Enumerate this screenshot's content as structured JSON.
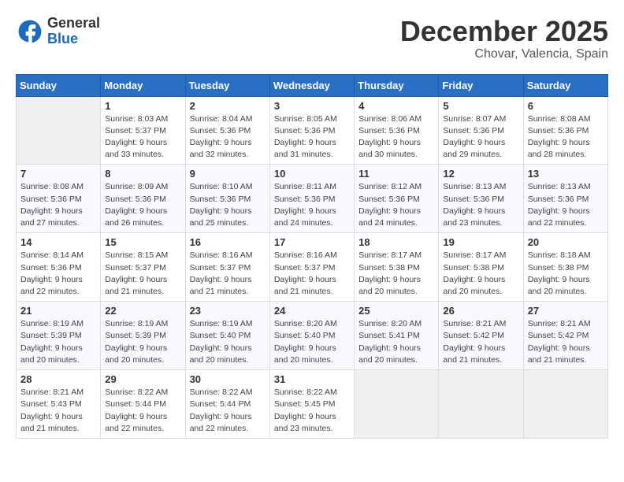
{
  "header": {
    "logo": {
      "general": "General",
      "blue": "Blue"
    },
    "month": "December 2025",
    "location": "Chovar, Valencia, Spain"
  },
  "weekdays": [
    "Sunday",
    "Monday",
    "Tuesday",
    "Wednesday",
    "Thursday",
    "Friday",
    "Saturday"
  ],
  "weeks": [
    [
      {
        "day": "",
        "info": ""
      },
      {
        "day": "1",
        "info": "Sunrise: 8:03 AM\nSunset: 5:37 PM\nDaylight: 9 hours\nand 33 minutes."
      },
      {
        "day": "2",
        "info": "Sunrise: 8:04 AM\nSunset: 5:36 PM\nDaylight: 9 hours\nand 32 minutes."
      },
      {
        "day": "3",
        "info": "Sunrise: 8:05 AM\nSunset: 5:36 PM\nDaylight: 9 hours\nand 31 minutes."
      },
      {
        "day": "4",
        "info": "Sunrise: 8:06 AM\nSunset: 5:36 PM\nDaylight: 9 hours\nand 30 minutes."
      },
      {
        "day": "5",
        "info": "Sunrise: 8:07 AM\nSunset: 5:36 PM\nDaylight: 9 hours\nand 29 minutes."
      },
      {
        "day": "6",
        "info": "Sunrise: 8:08 AM\nSunset: 5:36 PM\nDaylight: 9 hours\nand 28 minutes."
      }
    ],
    [
      {
        "day": "7",
        "info": "Sunrise: 8:08 AM\nSunset: 5:36 PM\nDaylight: 9 hours\nand 27 minutes."
      },
      {
        "day": "8",
        "info": "Sunrise: 8:09 AM\nSunset: 5:36 PM\nDaylight: 9 hours\nand 26 minutes."
      },
      {
        "day": "9",
        "info": "Sunrise: 8:10 AM\nSunset: 5:36 PM\nDaylight: 9 hours\nand 25 minutes."
      },
      {
        "day": "10",
        "info": "Sunrise: 8:11 AM\nSunset: 5:36 PM\nDaylight: 9 hours\nand 24 minutes."
      },
      {
        "day": "11",
        "info": "Sunrise: 8:12 AM\nSunset: 5:36 PM\nDaylight: 9 hours\nand 24 minutes."
      },
      {
        "day": "12",
        "info": "Sunrise: 8:13 AM\nSunset: 5:36 PM\nDaylight: 9 hours\nand 23 minutes."
      },
      {
        "day": "13",
        "info": "Sunrise: 8:13 AM\nSunset: 5:36 PM\nDaylight: 9 hours\nand 22 minutes."
      }
    ],
    [
      {
        "day": "14",
        "info": "Sunrise: 8:14 AM\nSunset: 5:36 PM\nDaylight: 9 hours\nand 22 minutes."
      },
      {
        "day": "15",
        "info": "Sunrise: 8:15 AM\nSunset: 5:37 PM\nDaylight: 9 hours\nand 21 minutes."
      },
      {
        "day": "16",
        "info": "Sunrise: 8:16 AM\nSunset: 5:37 PM\nDaylight: 9 hours\nand 21 minutes."
      },
      {
        "day": "17",
        "info": "Sunrise: 8:16 AM\nSunset: 5:37 PM\nDaylight: 9 hours\nand 21 minutes."
      },
      {
        "day": "18",
        "info": "Sunrise: 8:17 AM\nSunset: 5:38 PM\nDaylight: 9 hours\nand 20 minutes."
      },
      {
        "day": "19",
        "info": "Sunrise: 8:17 AM\nSunset: 5:38 PM\nDaylight: 9 hours\nand 20 minutes."
      },
      {
        "day": "20",
        "info": "Sunrise: 8:18 AM\nSunset: 5:38 PM\nDaylight: 9 hours\nand 20 minutes."
      }
    ],
    [
      {
        "day": "21",
        "info": "Sunrise: 8:19 AM\nSunset: 5:39 PM\nDaylight: 9 hours\nand 20 minutes."
      },
      {
        "day": "22",
        "info": "Sunrise: 8:19 AM\nSunset: 5:39 PM\nDaylight: 9 hours\nand 20 minutes."
      },
      {
        "day": "23",
        "info": "Sunrise: 8:19 AM\nSunset: 5:40 PM\nDaylight: 9 hours\nand 20 minutes."
      },
      {
        "day": "24",
        "info": "Sunrise: 8:20 AM\nSunset: 5:40 PM\nDaylight: 9 hours\nand 20 minutes."
      },
      {
        "day": "25",
        "info": "Sunrise: 8:20 AM\nSunset: 5:41 PM\nDaylight: 9 hours\nand 20 minutes."
      },
      {
        "day": "26",
        "info": "Sunrise: 8:21 AM\nSunset: 5:42 PM\nDaylight: 9 hours\nand 21 minutes."
      },
      {
        "day": "27",
        "info": "Sunrise: 8:21 AM\nSunset: 5:42 PM\nDaylight: 9 hours\nand 21 minutes."
      }
    ],
    [
      {
        "day": "28",
        "info": "Sunrise: 8:21 AM\nSunset: 5:43 PM\nDaylight: 9 hours\nand 21 minutes."
      },
      {
        "day": "29",
        "info": "Sunrise: 8:22 AM\nSunset: 5:44 PM\nDaylight: 9 hours\nand 22 minutes."
      },
      {
        "day": "30",
        "info": "Sunrise: 8:22 AM\nSunset: 5:44 PM\nDaylight: 9 hours\nand 22 minutes."
      },
      {
        "day": "31",
        "info": "Sunrise: 8:22 AM\nSunset: 5:45 PM\nDaylight: 9 hours\nand 23 minutes."
      },
      {
        "day": "",
        "info": ""
      },
      {
        "day": "",
        "info": ""
      },
      {
        "day": "",
        "info": ""
      }
    ]
  ]
}
